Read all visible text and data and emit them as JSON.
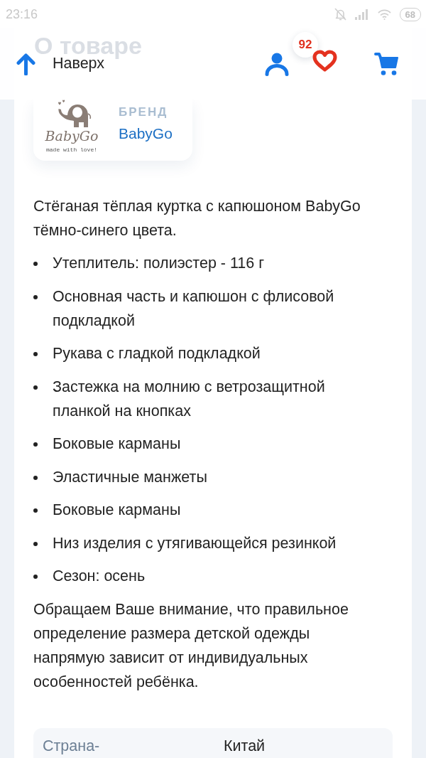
{
  "status_bar": {
    "time": "23:16",
    "battery": "68"
  },
  "header": {
    "page_title": "О товаре",
    "back_to_top": "Наверх",
    "favorites_count": "92"
  },
  "brand": {
    "logo_wordmark": "BabyGo",
    "logo_tagline": "made with love!",
    "label": "БРЕНД",
    "name": "BabyGo"
  },
  "description": "Стёганая тёплая куртка с капюшоном BabyGo тёмно-синего цвета.",
  "features": [
    "Утеплитель: полиэстер - 116 г",
    "Основная часть и капюшон с флисовой подкладкой",
    "Рукава с гладкой подкладкой",
    "Застежка на молнию с ветрозащитной планкой на кнопках",
    "Боковые карманы",
    "Эластичные манжеты",
    "Боковые карманы",
    "Низ изделия с утягивающейся резинкой",
    "Сезон: осень"
  ],
  "note": "Обращаем Ваше внимание, что правильное определение размера детской одежды напрямую зависит от индивидуальных особенностей ребёнка.",
  "specs": [
    {
      "label": "Страна-",
      "value": "Китай"
    }
  ]
}
